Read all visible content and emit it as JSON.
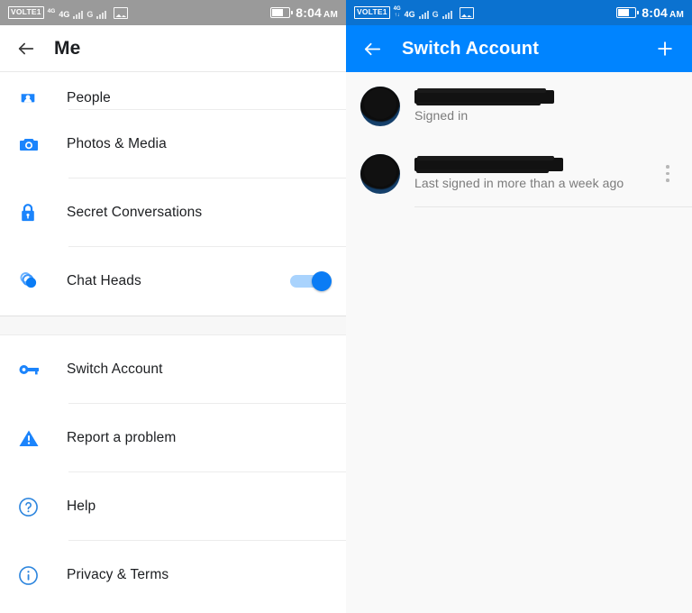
{
  "status_bar": {
    "carrier_badge": "VOLTE1",
    "network_sup": "4G",
    "network_label": "4G",
    "network_label_2": "G",
    "time": "8:04",
    "ampm": "AM",
    "icons": {
      "data_arrows": "data-transfer-icon",
      "signal": "signal-bars-icon",
      "second_signal": "signal-bars-icon",
      "gallery": "image-icon",
      "battery": "battery-icon"
    },
    "left_background": "#9a9a9a",
    "right_background": "#0b72d0"
  },
  "left_screen": {
    "header": {
      "back_icon": "back-arrow-icon",
      "title": "Me"
    },
    "groups": [
      {
        "items": [
          {
            "icon": "people-icon",
            "label": "People",
            "clipped": true,
            "toggle": null
          },
          {
            "icon": "camera-icon",
            "label": "Photos & Media",
            "clipped": false,
            "toggle": null
          },
          {
            "icon": "lock-icon",
            "label": "Secret Conversations",
            "clipped": false,
            "toggle": null
          },
          {
            "icon": "chat-heads-icon",
            "label": "Chat Heads",
            "clipped": false,
            "toggle": "on"
          }
        ]
      },
      {
        "items": [
          {
            "icon": "key-icon",
            "label": "Switch Account",
            "clipped": false,
            "toggle": null
          },
          {
            "icon": "warning-triangle-icon",
            "label": "Report a problem",
            "clipped": false,
            "toggle": null
          },
          {
            "icon": "help-circle-icon",
            "label": "Help",
            "clipped": false,
            "toggle": null
          },
          {
            "icon": "info-circle-icon",
            "label": "Privacy & Terms",
            "clipped": false,
            "toggle": null
          }
        ]
      }
    ]
  },
  "right_screen": {
    "header": {
      "back_icon": "back-arrow-icon",
      "title": "Switch Account",
      "add_icon": "plus-icon"
    },
    "accounts": [
      {
        "name": "",
        "name_redacted": true,
        "status": "Signed in",
        "has_overflow": false,
        "avatar": "user-avatar"
      },
      {
        "name": "",
        "name_redacted": true,
        "status": "Last signed in more than a week ago",
        "has_overflow": true,
        "avatar": "user-avatar"
      }
    ]
  },
  "colors": {
    "accent_blue": "#0084ff",
    "icon_blue": "#1b84fc",
    "status_blue": "#0b72d0",
    "status_gray": "#9a9a9a",
    "text_primary": "#1c1e21",
    "text_secondary": "#7b7b7b",
    "panel_bg": "#f9f9f9"
  }
}
